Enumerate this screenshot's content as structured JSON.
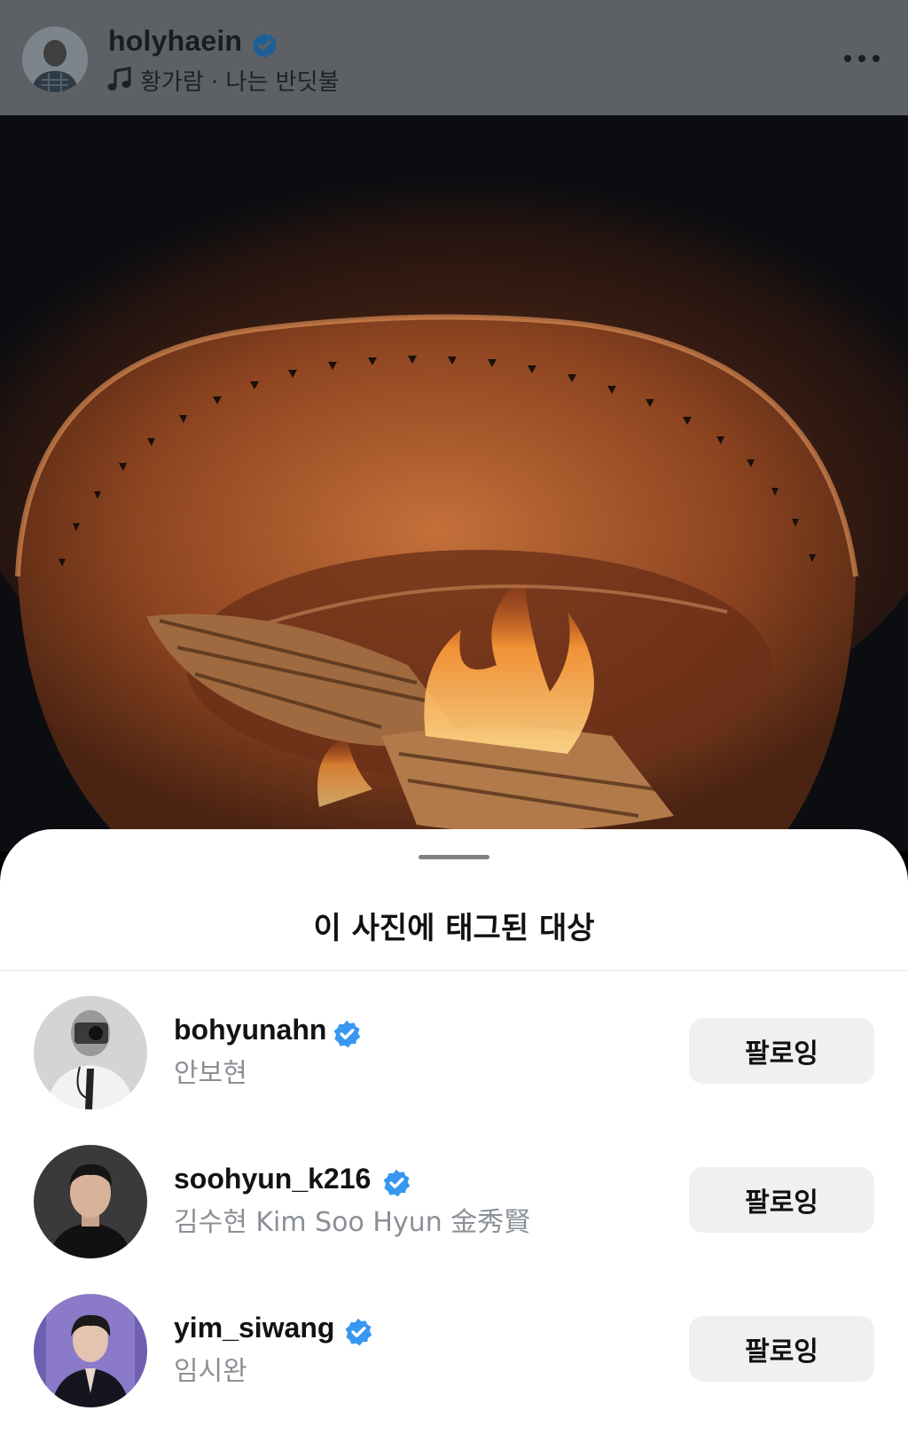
{
  "post": {
    "username": "holyhaein",
    "music": "황가람 · 나는 반딧불",
    "photo_icon": "fire-pit-photo"
  },
  "tags_sheet": {
    "title": "이 사진에 태그된 대상",
    "rows": [
      {
        "username": "bohyunahn",
        "full_name": "안보현",
        "button": "팔로잉",
        "verified": true
      },
      {
        "username": "soohyun_k216",
        "full_name": "김수현 Kim Soo Hyun 金秀賢",
        "button": "팔로잉",
        "verified": true
      },
      {
        "username": "yim_siwang",
        "full_name": "임시완",
        "button": "팔로잉",
        "verified": true
      }
    ]
  },
  "colors": {
    "verified_blue": "#3897f0",
    "button_bg": "#eff0f2",
    "secondary_text": "#8b9096",
    "header_dim": "#5d6165"
  }
}
